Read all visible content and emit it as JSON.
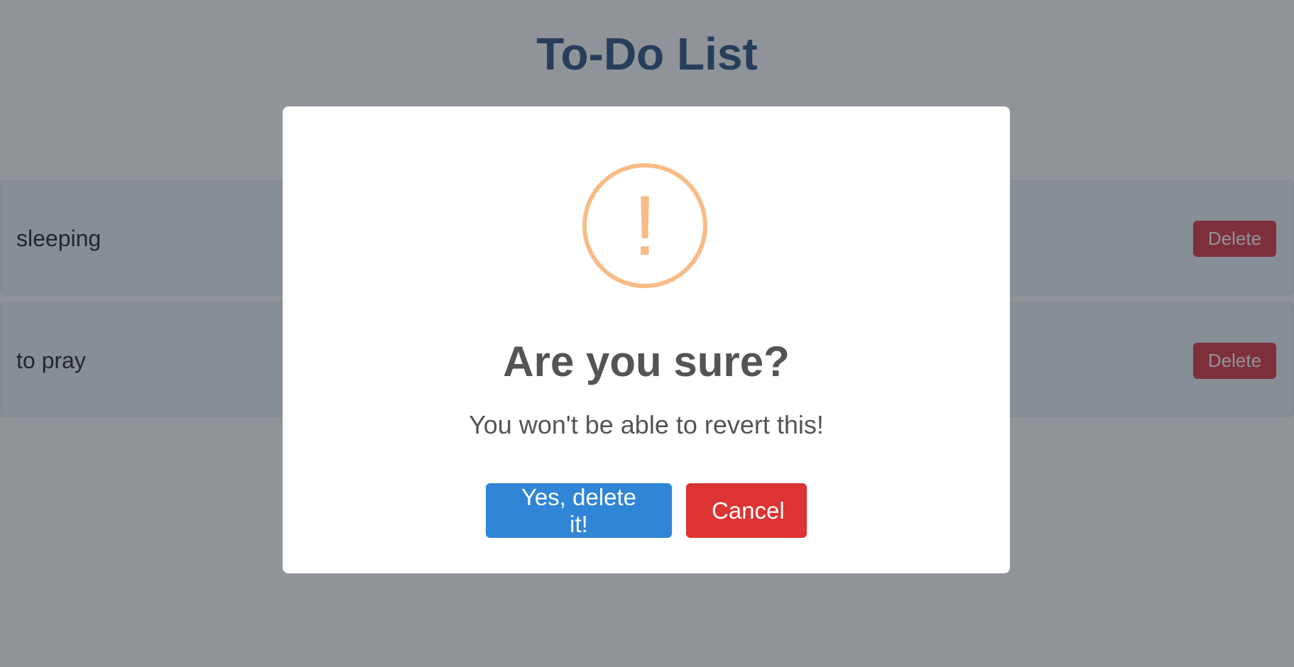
{
  "page": {
    "title": "To-Do List"
  },
  "todos": [
    {
      "text": "sleeping",
      "delete_label": "Delete"
    },
    {
      "text": "to pray",
      "delete_label": "Delete"
    }
  ],
  "dialog": {
    "icon": "warning-icon",
    "icon_glyph": "!",
    "title": "Are you sure?",
    "text": "You won't be able to revert this!",
    "confirm_label": "Yes, delete it!",
    "cancel_label": "Cancel"
  },
  "colors": {
    "title": "#2c5282",
    "delete": "#dc3545",
    "warning": "#f8bb86",
    "confirm": "#3085d6",
    "cancel": "#dd3333"
  }
}
